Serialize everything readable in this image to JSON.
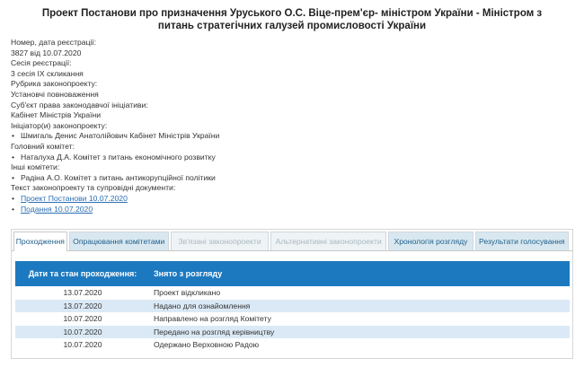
{
  "title": "Проект Постанови про призначення Уруського О.С. Віце-прем'єр- міністром України - Міністром з питань стратегічних галузей промисловості України",
  "info": {
    "reg_label": "Номер, дата реєстрації:",
    "reg_value": "3827 від 10.07.2020",
    "session_label": "Сесія реєстрації:",
    "session_value": "3 сесія IX скликання",
    "rubric_label": "Рубрика законопроекту:",
    "rubric_value": "Установчі повноваження",
    "subject_label": "Суб'єкт права законодавчої ініціативи:",
    "subject_value": "Кабінет Міністрів України",
    "initiators_label": "Ініціатор(и) законопроекту:",
    "initiators": [
      "Шмигаль Денис Анатолійович Кабінет Міністрів України"
    ],
    "main_committee_label": "Головний комітет:",
    "main_committee": [
      "Наталуха Д.А. Комітет з питань економічного розвитку"
    ],
    "other_committees_label": "Інші комітети:",
    "other_committees": [
      "Радіна А.О. Комітет з питань антикорупційної політики"
    ],
    "docs_label": "Текст законопроекту та супровідні документи:",
    "docs": [
      "Проект Постанови 10.07.2020",
      "Подання 10.07.2020"
    ]
  },
  "tabs": [
    {
      "label": "Проходження",
      "state": "active"
    },
    {
      "label": "Опрацювання комітетами",
      "state": "normal"
    },
    {
      "label": "Зв'язані законопроекти",
      "state": "disabled"
    },
    {
      "label": "Альтернативні законопроекти",
      "state": "disabled"
    },
    {
      "label": "Хронологія розгляду",
      "state": "normal"
    },
    {
      "label": "Результати голосування",
      "state": "normal"
    }
  ],
  "table": {
    "header_col1": "Дати та стан проходження:",
    "header_col2": "Знято з розгляду",
    "rows": [
      {
        "date": "13.07.2020",
        "event": "Проект відкликано"
      },
      {
        "date": "13.07.2020",
        "event": "Надано для ознайомлення"
      },
      {
        "date": "10.07.2020",
        "event": "Направлено на розгляд Комітету"
      },
      {
        "date": "10.07.2020",
        "event": "Передано на розгляд керівництву"
      },
      {
        "date": "10.07.2020",
        "event": "Одержано Верховною Радою"
      }
    ]
  }
}
